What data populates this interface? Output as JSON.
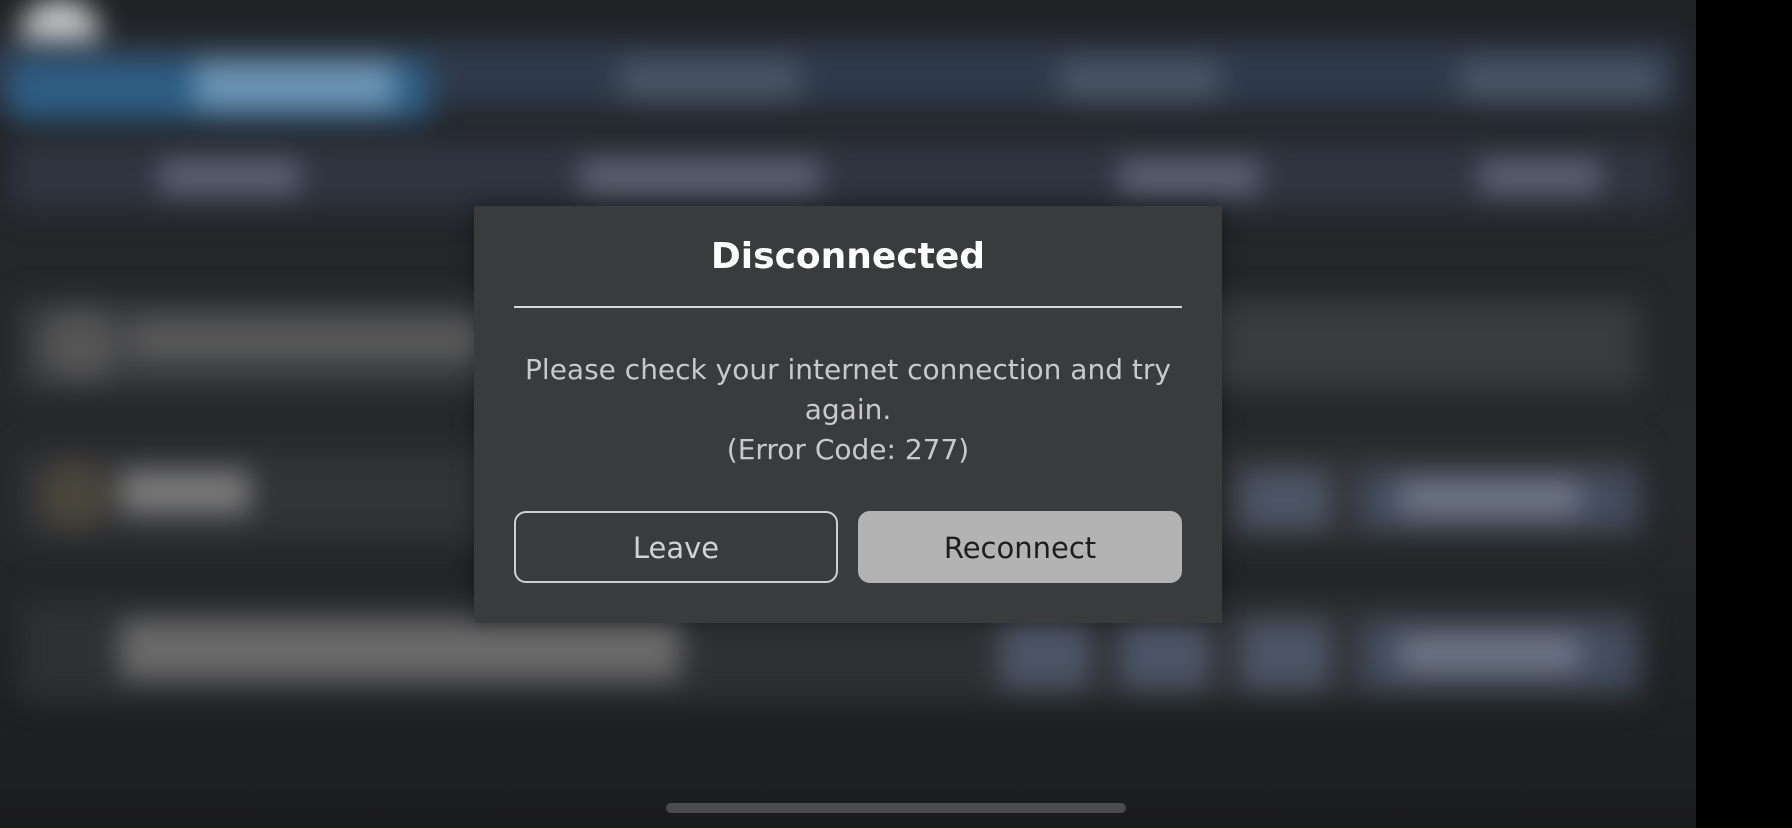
{
  "dialog": {
    "title": "Disconnected",
    "message_line1": "Please check your internet connection and try",
    "message_line2": "again.",
    "error_code": "(Error Code: 277)",
    "leave_label": "Leave",
    "reconnect_label": "Reconnect"
  },
  "colors": {
    "modal_background": "#3a3b3d",
    "title_text": "#ffffff",
    "message_text": "#c9c9c9",
    "reconnect_button": "#b3b3b3",
    "leave_border": "#cfcfcf"
  }
}
